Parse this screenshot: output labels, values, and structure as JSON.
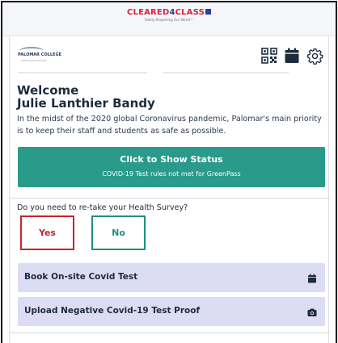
{
  "brand": {
    "name_part1": "CLEARED",
    "name_part2": "4",
    "name_part3": "CLASS",
    "tagline": "Safely Reopening Our World™"
  },
  "header": {
    "logo_text": "PALOMAR COLLEGE",
    "logo_sub": "Learning for Success",
    "icons": [
      "qr-code-icon",
      "calendar-icon",
      "gear-icon"
    ]
  },
  "welcome": {
    "greeting": "Welcome",
    "name": "Julie Lanthier Bandy",
    "intro": "In the midst of the 2020 global Coronavirus pandemic, Palomar's main priority is to keep their staff and students as safe as possible."
  },
  "status": {
    "title": "Click to Show Status",
    "subtitle": "COVID-19 Test rules not met for GreenPass",
    "color": "#2a9a8a"
  },
  "survey": {
    "question": "Do you need to re-take your Health Survey?",
    "yes_label": "Yes",
    "no_label": "No"
  },
  "actions": [
    {
      "label": "Book On-site Covid Test",
      "icon": "calendar-icon"
    },
    {
      "label": "Upload Negative Covid-19 Test Proof",
      "icon": "camera-icon"
    }
  ],
  "colors": {
    "brand_red": "#d6253a",
    "brand_blue": "#2b3fa8",
    "teal": "#2a9a8a",
    "yes_red": "#c8232c",
    "action_bg": "#dcdcf5"
  }
}
